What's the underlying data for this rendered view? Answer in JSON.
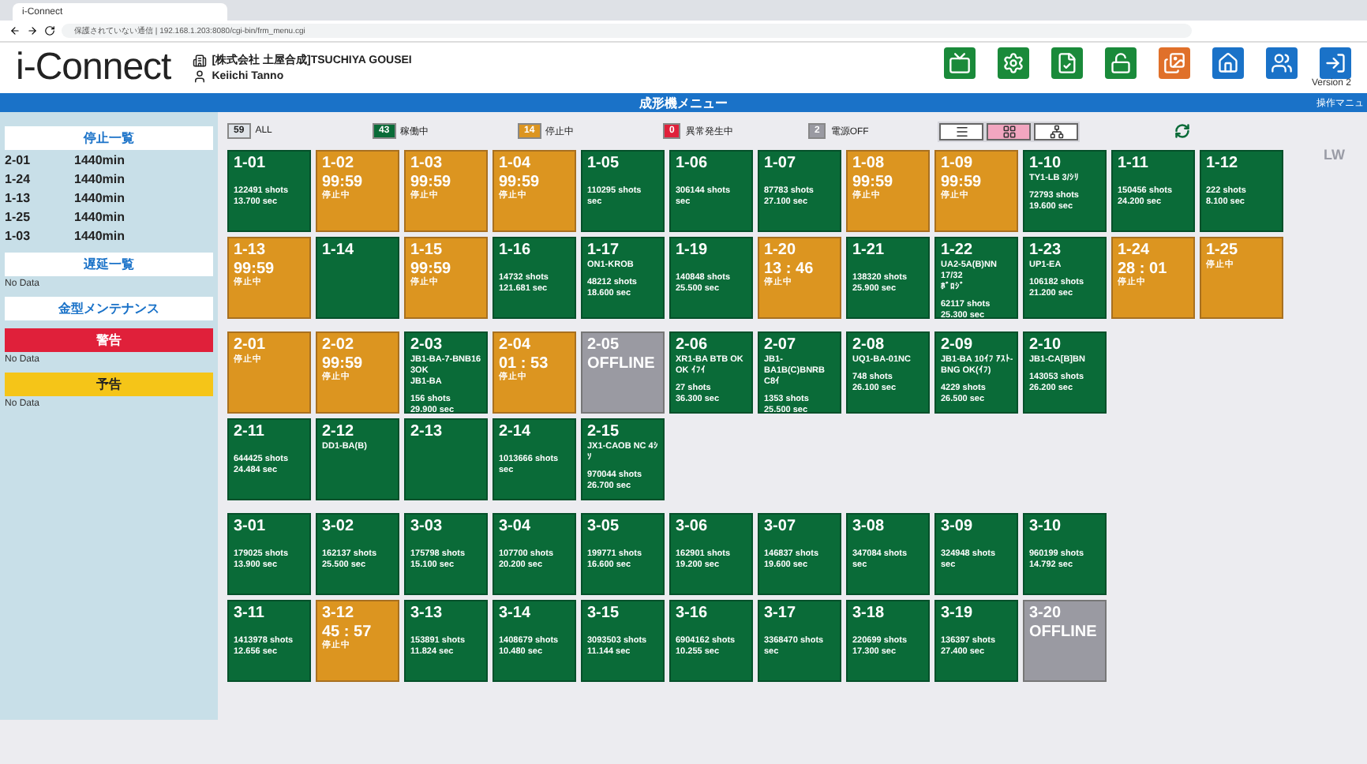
{
  "browser": {
    "tab_title": "i-Connect",
    "address": "保護されていない通信 | 192.168.1.203:8080/cgi-bin/frm_menu.cgi"
  },
  "header": {
    "logo": "i-Connect",
    "company": "[株式会社 土屋合成]TSUCHIYA GOUSEI",
    "user": "Keiichi Tanno",
    "version": "Version 2"
  },
  "title_bar": {
    "title": "成形機メニュー",
    "right_link": "操作マニュ"
  },
  "sidebar": {
    "sections": [
      {
        "kind": "list",
        "title": "停止一覧",
        "items": [
          {
            "machine": "2-01",
            "time": "1440min"
          },
          {
            "machine": "1-24",
            "time": "1440min"
          },
          {
            "machine": "1-13",
            "time": "1440min"
          },
          {
            "machine": "1-25",
            "time": "1440min"
          },
          {
            "machine": "1-03",
            "time": "1440min"
          }
        ]
      },
      {
        "kind": "empty",
        "title": "遅延一覧",
        "note": "No Data"
      },
      {
        "kind": "heading",
        "title": "金型メンテナンス"
      },
      {
        "kind": "alert",
        "title": "警告",
        "note": "No Data",
        "color": "#e0203a"
      },
      {
        "kind": "alert",
        "title": "予告",
        "note": "No Data",
        "color": "#f5c518"
      }
    ]
  },
  "legend": [
    {
      "count": "59",
      "label": "ALL",
      "color": "#dfe3e8"
    },
    {
      "count": "43",
      "label": "稼働中",
      "color": "#0a6b38"
    },
    {
      "count": "14",
      "label": "停止中",
      "color": "#dc9520"
    },
    {
      "count": "0",
      "label": "異常発生中",
      "color": "#e0203a"
    },
    {
      "count": "2",
      "label": "電源OFF",
      "color": "#9a9aa2"
    }
  ],
  "views": [
    {
      "kind": "list",
      "selected": false
    },
    {
      "kind": "tiles",
      "selected": true
    },
    {
      "kind": "layout",
      "selected": false
    }
  ],
  "side_mark": "LW",
  "groups": [
    {
      "rows": [
        [
          {
            "machine": "1-01",
            "kind": "running",
            "stats": [
              "122491 shots",
              "13.700 sec"
            ]
          },
          {
            "machine": "1-02",
            "kind": "stopped",
            "timer": "99:59",
            "state": "停止中"
          },
          {
            "machine": "1-03",
            "kind": "stopped",
            "timer": "99:59",
            "state": "停止中"
          },
          {
            "machine": "1-04",
            "kind": "stopped",
            "timer": "99:59",
            "state": "停止中"
          },
          {
            "machine": "1-05",
            "kind": "running",
            "stats": [
              "110295 shots",
              "sec"
            ]
          },
          {
            "machine": "1-06",
            "kind": "running",
            "stats": [
              "306144 shots",
              "sec"
            ]
          },
          {
            "machine": "1-07",
            "kind": "running",
            "stats": [
              "87783 shots",
              "27.100 sec"
            ]
          },
          {
            "machine": "1-08",
            "kind": "stopped",
            "timer": "99:59",
            "state": "停止中"
          },
          {
            "machine": "1-09",
            "kind": "stopped",
            "timer": "99:59",
            "state": "停止中"
          },
          {
            "machine": "1-10",
            "kind": "running",
            "detail": [
              "TY1-LB 3/ｼﾘ"
            ],
            "stats": [
              "72793 shots",
              "19.600 sec"
            ]
          },
          {
            "machine": "1-11",
            "kind": "running",
            "stats": [
              "150456 shots",
              "24.200 sec"
            ]
          },
          {
            "machine": "1-12",
            "kind": "running",
            "stats": [
              "222 shots",
              "8.100 sec"
            ]
          }
        ],
        [
          {
            "machine": "1-13",
            "kind": "stopped",
            "timer": "99:59",
            "state": "停止中"
          },
          {
            "machine": "1-14",
            "kind": "running"
          },
          {
            "machine": "1-15",
            "kind": "stopped",
            "timer": "99:59",
            "state": "停止中"
          },
          {
            "machine": "1-16",
            "kind": "running",
            "stats": [
              "14732 shots",
              "121.681 sec"
            ]
          },
          {
            "machine": "1-17",
            "kind": "running",
            "detail": [
              "ON1-KROB"
            ],
            "stats": [
              "48212 shots",
              "18.600 sec"
            ]
          },
          {
            "machine": "1-19",
            "kind": "running",
            "stats": [
              "140848 shots",
              "25.500 sec"
            ]
          },
          {
            "machine": "1-20",
            "kind": "stopped",
            "timer": "13 : 46",
            "state": "停止中"
          },
          {
            "machine": "1-21",
            "kind": "running",
            "stats": [
              "138320 shots",
              "25.900 sec"
            ]
          },
          {
            "machine": "1-22",
            "kind": "running",
            "detail": [
              "UA2-5A(B)NN",
              "17/32",
              "ﾎﾞﾛｼﾞ"
            ],
            "stats": [
              "62117 shots",
              "25.300 sec"
            ]
          },
          {
            "machine": "1-23",
            "kind": "running",
            "detail": [
              "UP1-EA"
            ],
            "stats": [
              "106182 shots",
              "21.200 sec"
            ]
          },
          {
            "machine": "1-24",
            "kind": "stopped",
            "timer": "28 : 01",
            "state": "停止中"
          },
          {
            "machine": "1-25",
            "kind": "stopped",
            "state": "停止中"
          }
        ]
      ]
    },
    {
      "rows": [
        [
          {
            "machine": "2-01",
            "kind": "stopped",
            "state": "停止中"
          },
          {
            "machine": "2-02",
            "kind": "stopped",
            "timer": "99:59",
            "state": "停止中"
          },
          {
            "machine": "2-03",
            "kind": "running",
            "detail": [
              "JB1-BA-7-BNB16",
              "3OK",
              "JB1-BA"
            ],
            "stats": [
              "156 shots",
              "29.900 sec"
            ]
          },
          {
            "machine": "2-04",
            "kind": "stopped",
            "timer": "01 : 53",
            "state": "停止中"
          },
          {
            "machine": "2-05",
            "kind": "offline",
            "timer": "OFFLINE"
          },
          {
            "machine": "2-06",
            "kind": "running",
            "detail": [
              "XR1-BA BTB OK",
              "OK ｲﾌｲ"
            ],
            "stats": [
              "27 shots",
              "36.300 sec"
            ]
          },
          {
            "machine": "2-07",
            "kind": "running",
            "detail": [
              "JB1-",
              "BA1B(C)BNRB",
              "C8ｲ"
            ],
            "stats": [
              "1353 shots",
              "25.500 sec"
            ]
          },
          {
            "machine": "2-08",
            "kind": "running",
            "detail": [
              "UQ1-BA-01NC"
            ],
            "stats": [
              "748 shots",
              "26.100 sec"
            ]
          },
          {
            "machine": "2-09",
            "kind": "running",
            "detail": [
              "JB1-BA 10ｲﾌ ｱｽﾄ-",
              "BNG OK(ｲﾌ)"
            ],
            "stats": [
              "4229 shots",
              "26.500 sec"
            ]
          },
          {
            "machine": "2-10",
            "kind": "running",
            "detail": [
              "JB1-CA[B]BN"
            ],
            "stats": [
              "143053 shots",
              "26.200 sec"
            ]
          }
        ],
        [
          {
            "machine": "2-11",
            "kind": "running",
            "stats": [
              "644425 shots",
              "24.484 sec"
            ]
          },
          {
            "machine": "2-12",
            "kind": "running",
            "detail": [
              "DD1-BA(B)"
            ]
          },
          {
            "machine": "2-13",
            "kind": "running"
          },
          {
            "machine": "2-14",
            "kind": "running",
            "stats": [
              "1013666 shots",
              "sec"
            ]
          },
          {
            "machine": "2-15",
            "kind": "running",
            "detail": [
              "JX1-CAOB NC 4ｼ",
              "ｿ"
            ],
            "stats": [
              "970044 shots",
              "26.700 sec"
            ]
          }
        ]
      ]
    },
    {
      "rows": [
        [
          {
            "machine": "3-01",
            "kind": "running",
            "stats": [
              "179025 shots",
              "13.900 sec"
            ]
          },
          {
            "machine": "3-02",
            "kind": "running",
            "stats": [
              "162137 shots",
              "25.500 sec"
            ]
          },
          {
            "machine": "3-03",
            "kind": "running",
            "stats": [
              "175798 shots",
              "15.100 sec"
            ]
          },
          {
            "machine": "3-04",
            "kind": "running",
            "stats": [
              "107700 shots",
              "20.200 sec"
            ]
          },
          {
            "machine": "3-05",
            "kind": "running",
            "stats": [
              "199771 shots",
              "16.600 sec"
            ]
          },
          {
            "machine": "3-06",
            "kind": "running",
            "stats": [
              "162901 shots",
              "19.200 sec"
            ]
          },
          {
            "machine": "3-07",
            "kind": "running",
            "stats": [
              "146837 shots",
              "19.600 sec"
            ]
          },
          {
            "machine": "3-08",
            "kind": "running",
            "stats": [
              "347084 shots",
              "sec"
            ]
          },
          {
            "machine": "3-09",
            "kind": "running",
            "stats": [
              "324948 shots",
              "sec"
            ]
          },
          {
            "machine": "3-10",
            "kind": "running",
            "stats": [
              "960199 shots",
              "14.792 sec"
            ]
          }
        ],
        [
          {
            "machine": "3-11",
            "kind": "running",
            "stats": [
              "1413978 shots",
              "12.656 sec"
            ]
          },
          {
            "machine": "3-12",
            "kind": "stopped",
            "timer": "45 : 57",
            "state": "停止中"
          },
          {
            "machine": "3-13",
            "kind": "running",
            "stats": [
              "153891 shots",
              "11.824 sec"
            ]
          },
          {
            "machine": "3-14",
            "kind": "running",
            "stats": [
              "1408679 shots",
              "10.480 sec"
            ]
          },
          {
            "machine": "3-15",
            "kind": "running",
            "stats": [
              "3093503 shots",
              "11.144 sec"
            ]
          },
          {
            "machine": "3-16",
            "kind": "running",
            "stats": [
              "6904162 shots",
              "10.255 sec"
            ]
          },
          {
            "machine": "3-17",
            "kind": "running",
            "stats": [
              "3368470 shots",
              "sec"
            ]
          },
          {
            "machine": "3-18",
            "kind": "running",
            "stats": [
              "220699 shots",
              "17.300 sec"
            ]
          },
          {
            "machine": "3-19",
            "kind": "running",
            "stats": [
              "136397 shots",
              "27.400 sec"
            ]
          },
          {
            "machine": "3-20",
            "kind": "offline",
            "timer": "OFFLINE"
          }
        ]
      ]
    }
  ]
}
